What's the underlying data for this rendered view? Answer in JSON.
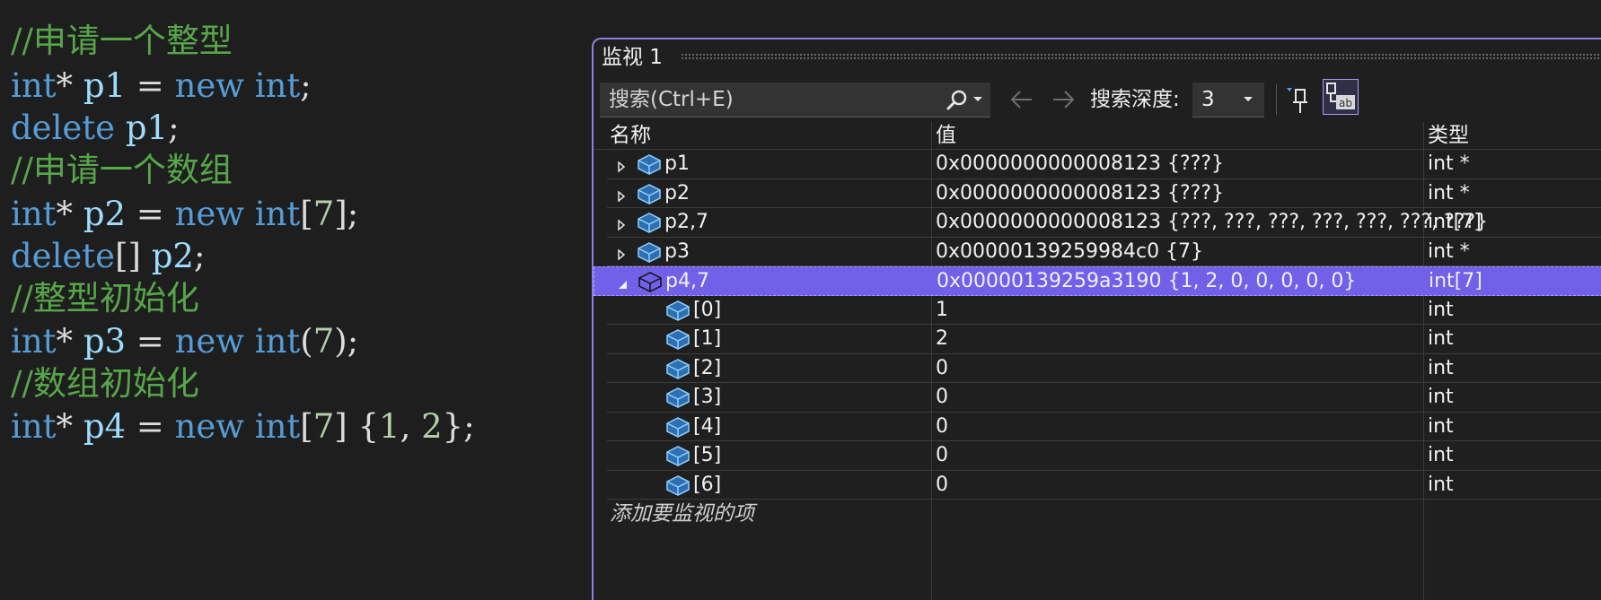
{
  "editor": {
    "lines": [
      {
        "type": "comment",
        "text": "//申请一个整型"
      },
      {
        "type": "code",
        "tokens": [
          {
            "c": "kw",
            "t": "int"
          },
          {
            "c": "pl",
            "t": "* "
          },
          {
            "c": "id",
            "t": "p1"
          },
          {
            "c": "pl",
            "t": " = "
          },
          {
            "c": "kw",
            "t": "new"
          },
          {
            "c": "pl",
            "t": " "
          },
          {
            "c": "kw",
            "t": "int"
          },
          {
            "c": "pl",
            "t": ";"
          }
        ]
      },
      {
        "type": "code",
        "tokens": [
          {
            "c": "kw",
            "t": "delete"
          },
          {
            "c": "pl",
            "t": " "
          },
          {
            "c": "id",
            "t": "p1"
          },
          {
            "c": "pl",
            "t": ";"
          }
        ]
      },
      {
        "type": "comment",
        "text": "//申请一个数组"
      },
      {
        "type": "code",
        "tokens": [
          {
            "c": "kw",
            "t": "int"
          },
          {
            "c": "pl",
            "t": "* "
          },
          {
            "c": "id",
            "t": "p2"
          },
          {
            "c": "pl",
            "t": " = "
          },
          {
            "c": "kw",
            "t": "new"
          },
          {
            "c": "pl",
            "t": " "
          },
          {
            "c": "kw",
            "t": "int"
          },
          {
            "c": "pl",
            "t": "["
          },
          {
            "c": "num",
            "t": "7"
          },
          {
            "c": "pl",
            "t": "];"
          }
        ]
      },
      {
        "type": "code",
        "tokens": [
          {
            "c": "kw",
            "t": "delete"
          },
          {
            "c": "pl",
            "t": "[] "
          },
          {
            "c": "id",
            "t": "p2"
          },
          {
            "c": "pl",
            "t": ";"
          }
        ]
      },
      {
        "type": "comment",
        "text": "//整型初始化"
      },
      {
        "type": "code",
        "tokens": [
          {
            "c": "kw",
            "t": "int"
          },
          {
            "c": "pl",
            "t": "* "
          },
          {
            "c": "id",
            "t": "p3"
          },
          {
            "c": "pl",
            "t": " = "
          },
          {
            "c": "kw",
            "t": "new"
          },
          {
            "c": "pl",
            "t": " "
          },
          {
            "c": "kw",
            "t": "int"
          },
          {
            "c": "pl",
            "t": "("
          },
          {
            "c": "num",
            "t": "7"
          },
          {
            "c": "pl",
            "t": ");"
          }
        ]
      },
      {
        "type": "comment",
        "text": "//数组初始化"
      },
      {
        "type": "code",
        "tokens": [
          {
            "c": "kw",
            "t": "int"
          },
          {
            "c": "pl",
            "t": "* "
          },
          {
            "c": "id",
            "t": "p4"
          },
          {
            "c": "pl",
            "t": " = "
          },
          {
            "c": "kw",
            "t": "new"
          },
          {
            "c": "pl",
            "t": " "
          },
          {
            "c": "kw",
            "t": "int"
          },
          {
            "c": "pl",
            "t": "["
          },
          {
            "c": "num",
            "t": "7"
          },
          {
            "c": "pl",
            "t": "] {"
          },
          {
            "c": "num",
            "t": "1"
          },
          {
            "c": "pl",
            "t": ", "
          },
          {
            "c": "num",
            "t": "2"
          },
          {
            "c": "pl",
            "t": "};"
          }
        ]
      }
    ]
  },
  "watch": {
    "title": "监视 1",
    "search_placeholder": "搜索(Ctrl+E)",
    "depth_label": "搜索深度:",
    "depth_value": "3",
    "columns": {
      "name": "名称",
      "value": "值",
      "type": "类型"
    },
    "rows": [
      {
        "name": "p1",
        "value": "0x0000000000008123 {???}",
        "type": "int *",
        "expandable": true,
        "expanded": false,
        "child": false,
        "selected": false
      },
      {
        "name": "p2",
        "value": "0x0000000000008123 {???}",
        "type": "int *",
        "expandable": true,
        "expanded": false,
        "child": false,
        "selected": false
      },
      {
        "name": "p2,7",
        "value": "0x0000000000008123 {???, ???, ???, ???, ???, ???, ???}",
        "type": "int[7]",
        "expandable": true,
        "expanded": false,
        "child": false,
        "selected": false
      },
      {
        "name": "p3",
        "value": "0x00000139259984c0 {7}",
        "type": "int *",
        "expandable": true,
        "expanded": false,
        "child": false,
        "selected": false
      },
      {
        "name": "p4,7",
        "value": "0x00000139259a3190 {1, 2, 0, 0, 0, 0, 0}",
        "type": "int[7]",
        "expandable": true,
        "expanded": true,
        "child": false,
        "selected": true
      },
      {
        "name": "[0]",
        "value": "1",
        "type": "int",
        "expandable": false,
        "child": true,
        "selected": false
      },
      {
        "name": "[1]",
        "value": "2",
        "type": "int",
        "expandable": false,
        "child": true,
        "selected": false
      },
      {
        "name": "[2]",
        "value": "0",
        "type": "int",
        "expandable": false,
        "child": true,
        "selected": false
      },
      {
        "name": "[3]",
        "value": "0",
        "type": "int",
        "expandable": false,
        "child": true,
        "selected": false
      },
      {
        "name": "[4]",
        "value": "0",
        "type": "int",
        "expandable": false,
        "child": true,
        "selected": false
      },
      {
        "name": "[5]",
        "value": "0",
        "type": "int",
        "expandable": false,
        "child": true,
        "selected": false
      },
      {
        "name": "[6]",
        "value": "0",
        "type": "int",
        "expandable": false,
        "child": true,
        "selected": false
      }
    ],
    "add_item_placeholder": "添加要监视的项",
    "icons": {
      "search": "search-icon",
      "back": "arrow-left-icon",
      "forward": "arrow-right-icon",
      "pin": "pin-icon",
      "hex": "hex-display-icon",
      "object": "object-icon"
    },
    "colors": {
      "accent": "#7160e8",
      "border": "#8b80e6",
      "object_icon": "#4aa3f0"
    }
  }
}
